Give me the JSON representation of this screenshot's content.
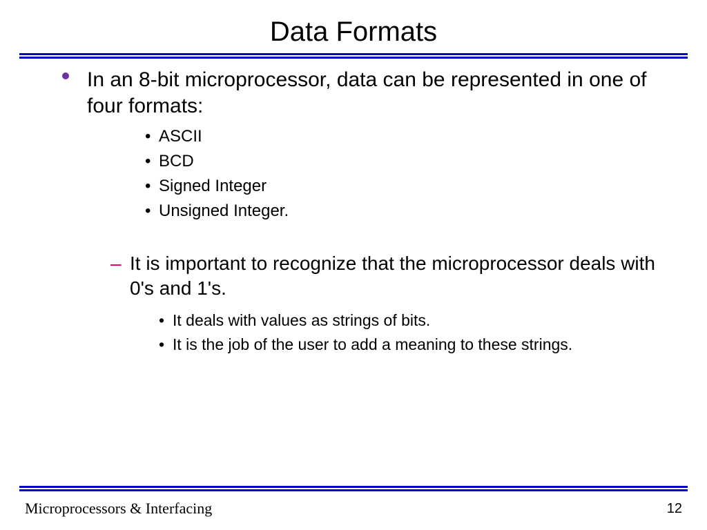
{
  "title": "Data Formats",
  "bullets": {
    "main": "In an 8-bit microprocessor, data can be represented in one of four formats:",
    "formats": [
      "ASCII",
      "BCD",
      "Signed Integer",
      "Unsigned Integer."
    ],
    "note": "It is important to recognize that the microprocessor deals with 0's and 1's.",
    "subnotes": [
      "It deals with values as strings of bits.",
      "It is the job of the user to add a meaning to these strings."
    ]
  },
  "footer": {
    "left": "Microprocessors & Interfacing",
    "page": "12"
  }
}
